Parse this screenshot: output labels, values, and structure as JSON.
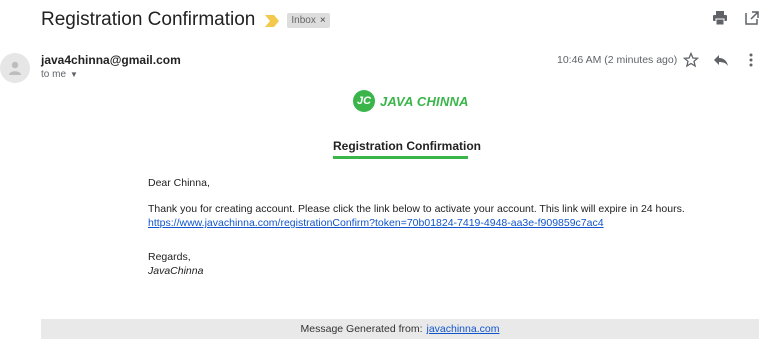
{
  "email": {
    "subject": "Registration Confirmation",
    "label_chip": "Inbox",
    "label_chip_close": "×",
    "sender": "java4chinna@gmail.com",
    "recipient": "to me",
    "timestamp": "10:46 AM (2 minutes ago)",
    "icons": [
      "print-icon",
      "open-new-window-icon",
      "star-icon",
      "reply-icon",
      "more-options-icon",
      "important-marker-icon"
    ]
  },
  "content": {
    "logo_badge": "JC",
    "logo_text": "JAVA CHINNA",
    "heading": "Registration Confirmation",
    "greeting": "Dear Chinna,",
    "paragraph": "Thank you for creating account. Please click the link below to activate your account. This link will expire in 24 hours.",
    "link": "https://www.javachinna.com/registrationConfirm?token=70b01824-7419-4948-aa3e-f909859c7ac4",
    "regards": "Regards,",
    "signature": "JavaChinna",
    "footer_prefix": "Message Generated from:",
    "footer_link": "javachinna.com"
  },
  "colors": {
    "brand_green": "#3ab54a",
    "link_blue": "#1155cc",
    "important_yellow": "#f2c94c"
  }
}
